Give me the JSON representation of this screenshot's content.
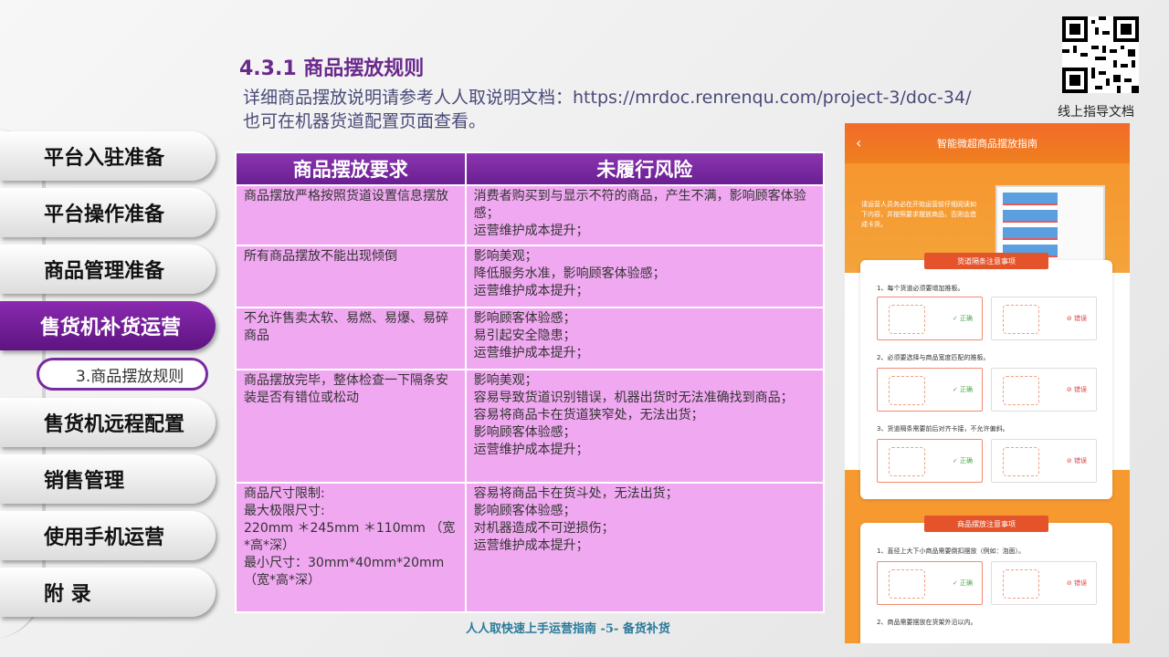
{
  "header": {
    "title": "4.3.1 商品摆放规则",
    "desc_line1": "详细商品摆放说明请参考人人取说明文档：https://mrdoc.renrenqu.com/project-3/doc-34/",
    "desc_line2": "也可在机器货道配置页面查看。",
    "qr_label": "线上指导文档"
  },
  "nav": {
    "items": [
      {
        "label": "平台入驻准备"
      },
      {
        "label": "平台操作准备"
      },
      {
        "label": "商品管理准备"
      },
      {
        "label": "售货机补货运营"
      },
      {
        "label": "售货机远程配置"
      },
      {
        "label": "销售管理"
      },
      {
        "label": "使用手机运营"
      },
      {
        "label": "附 录"
      }
    ],
    "sub_item": "3.商品摆放规则"
  },
  "table": {
    "headers": [
      "商品摆放要求",
      "未履行风险"
    ],
    "rows": [
      {
        "req": [
          "商品摆放严格按照货道设置信息摆放"
        ],
        "risk": [
          "消费者购买到与显示不符的商品，产生不满，影响顾客体验感；",
          "运营维护成本提升；"
        ]
      },
      {
        "req": [
          "所有商品摆放不能出现倾倒"
        ],
        "risk": [
          "影响美观；",
          "降低服务水准，影响顾客体验感；",
          "运营维护成本提升；"
        ]
      },
      {
        "req": [
          "不允许售卖太软、易燃、易爆、易碎商品"
        ],
        "risk": [
          "影响顾客体验感；",
          "易引起安全隐患；",
          "运营维护成本提升；"
        ]
      },
      {
        "req": [
          "商品摆放完毕，整体检查一下隔条安装是否有错位或松动"
        ],
        "risk": [
          "影响美观；",
          "容易导致货道识别错误，机器出货时无法准确找到商品；",
          "容易将商品卡在货道狭窄处，无法出货；",
          "影响顾客体验感；",
          "运营维护成本提升；"
        ]
      },
      {
        "req": [
          "商品尺寸限制:",
          "最大极限尺寸:",
          "220mm ＊245mm ＊110mm （宽*高*深）",
          "最小尺寸：30mm*40mm*20mm（宽*高*深）"
        ],
        "risk": [
          "容易将商品卡在货斗处，无法出货；",
          "影响顾客体验感；",
          "对机器造成不可逆损伤；",
          "运营维护成本提升；"
        ]
      }
    ]
  },
  "footer": "人人取快速上手运营指南 -5- 备货补货",
  "phone": {
    "title": "智能微超商品摆放指南",
    "back": "‹",
    "banner_text": "请运营人员务必在开始运营前仔细阅读如下内容，并按照要求摆放商品，否则会造成卡货。",
    "card1_title": "货道隔条注意事项",
    "card1_q1": "1、每个货道必须要增加推板。",
    "card1_q2": "2、必须要选择与商品宽度匹配的推板。",
    "card1_q3": "3、货道隔条需要前后对齐卡接，不允许偏斜。",
    "ok": "✓ 正确",
    "err": "⊘ 错误",
    "card2_title": "商品摆放注意事项",
    "card2_q1": "1、直径上大下小商品需要倒扣摆放（例如：泡面）。",
    "card2_q2": "2、商品需要摆放在货架外沿以内。"
  }
}
